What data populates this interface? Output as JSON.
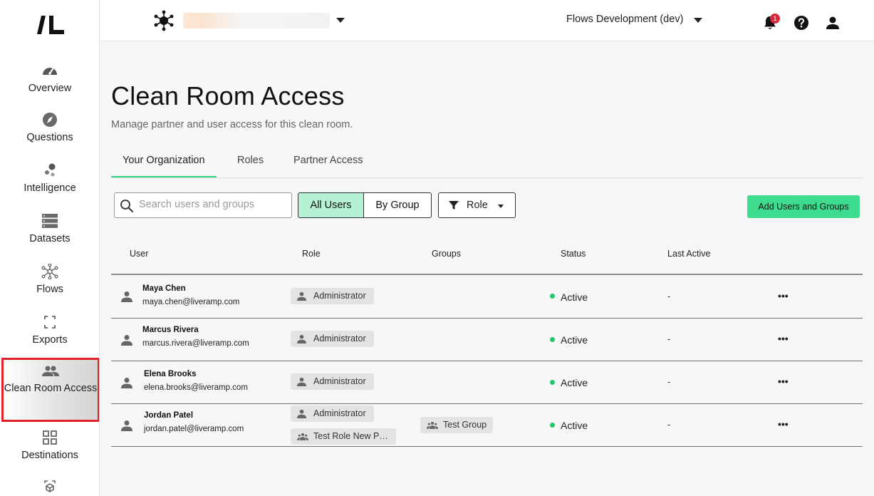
{
  "sidebar": {
    "items": [
      {
        "label": "Overview",
        "icon": "gauge-icon"
      },
      {
        "label": "Questions",
        "icon": "compass-icon"
      },
      {
        "label": "Intelligence",
        "icon": "bubbles-icon"
      },
      {
        "label": "Datasets",
        "icon": "database-icon"
      },
      {
        "label": "Flows",
        "icon": "network-icon"
      },
      {
        "label": "Exports",
        "icon": "corners-icon"
      },
      {
        "label": "Clean Room Access",
        "icon": "people-icon"
      },
      {
        "label": "Destinations",
        "icon": "grid-icon"
      }
    ]
  },
  "topbar": {
    "environment": "Flows Development (dev)",
    "notification_count": "1"
  },
  "page": {
    "title": "Clean Room Access",
    "subtitle": "Manage partner and user access for this clean room."
  },
  "tabs": [
    "Your Organization",
    "Roles",
    "Partner Access"
  ],
  "toolbar": {
    "search_placeholder": "Search users and groups",
    "all_users": "All Users",
    "by_group": "By Group",
    "role_filter": "Role",
    "add_button": "Add Users and Groups"
  },
  "table": {
    "headers": [
      "User",
      "Role",
      "Groups",
      "Status",
      "Last Active"
    ],
    "rows": [
      {
        "name": "Maya Chen",
        "email": "maya.chen@liveramp.com",
        "roles": [
          "Administrator"
        ],
        "group": "",
        "status": "Active",
        "last_active": "-"
      },
      {
        "name": "Marcus Rivera",
        "email": "marcus.rivera@liveramp.com",
        "roles": [
          "Administrator"
        ],
        "group": "",
        "status": "Active",
        "last_active": "-"
      },
      {
        "name": "Elena Brooks",
        "email": "elena.brooks@liveramp.com",
        "roles": [
          "Administrator"
        ],
        "group": "",
        "status": "Active",
        "last_active": "-"
      },
      {
        "name": "Jordan Patel",
        "email": "jordan.patel@liveramp.com",
        "roles": [
          "Administrator",
          "Test Role New Pe..."
        ],
        "group": "Test Group",
        "status": "Active",
        "last_active": "-"
      }
    ],
    "more_glyph": "•••"
  },
  "colors": {
    "accent": "#3ddc8e",
    "active_status": "#22c76c",
    "selected_segment": "#b5f1d3",
    "highlight_border": "#e0212a"
  }
}
